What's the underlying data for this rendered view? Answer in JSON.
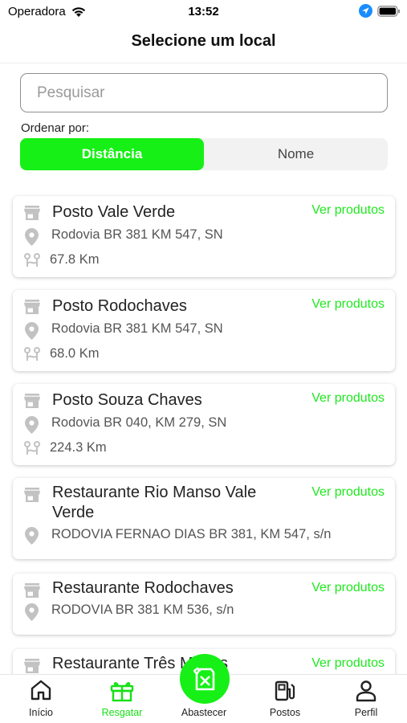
{
  "status_bar": {
    "carrier": "Operadora",
    "time": "13:52"
  },
  "header": {
    "title": "Selecione um local"
  },
  "search": {
    "placeholder": "Pesquisar"
  },
  "sort": {
    "label": "Ordenar por:",
    "options": [
      "Distância",
      "Nome"
    ],
    "selected": "Distância"
  },
  "colors": {
    "accent": "#16f016",
    "link": "#1ee81e",
    "icon_gray": "#c2c2c2"
  },
  "locations": [
    {
      "name": "Posto Vale Verde",
      "address": "Rodovia BR 381 KM 547, SN",
      "distance": "67.8 Km",
      "action": "Ver produtos"
    },
    {
      "name": "Posto Rodochaves",
      "address": "Rodovia BR 381 KM 547, SN",
      "distance": "68.0 Km",
      "action": "Ver produtos"
    },
    {
      "name": "Posto Souza Chaves",
      "address": "Rodovia BR 040, KM 279, SN",
      "distance": "224.3 Km",
      "action": "Ver produtos"
    },
    {
      "name": "Restaurante Rio Manso Vale Verde",
      "address": "RODOVIA FERNAO DIAS BR 381, KM 547, s/n",
      "action": "Ver produtos"
    },
    {
      "name": "Restaurante Rodochaves",
      "address": "RODOVIA BR 381 KM 536, s/n",
      "action": "Ver produtos"
    },
    {
      "name": "Restaurante Três Marias",
      "action": "Ver produtos"
    }
  ],
  "tabs": [
    {
      "label": "Início",
      "icon": "home-icon"
    },
    {
      "label": "Resgatar",
      "icon": "gift-icon",
      "active": true
    },
    {
      "label": "Abastecer",
      "icon": "fuel-can-icon"
    },
    {
      "label": "Postos",
      "icon": "gas-station-icon"
    },
    {
      "label": "Perfil",
      "icon": "user-icon"
    }
  ]
}
